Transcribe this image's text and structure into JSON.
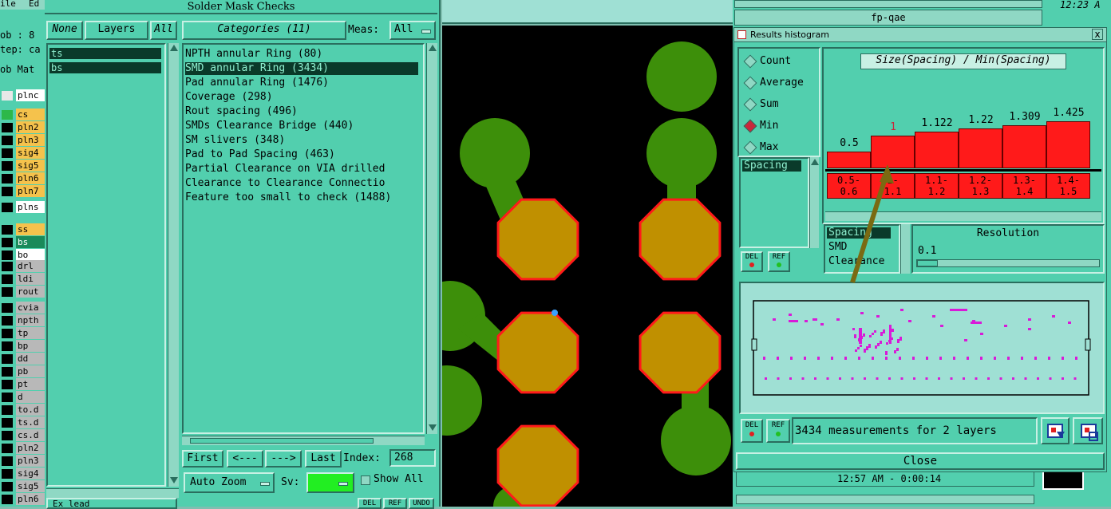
{
  "left_edge": {
    "menu": [
      "ile",
      "Ed"
    ],
    "rows": [
      "ob : 8",
      "tep: ca",
      "ob Mat"
    ]
  },
  "layers": [
    {
      "name": "plnc",
      "color": "#e8e8e8",
      "bg": "#ffffff"
    },
    {
      "name": "cs",
      "color": "#2db84a",
      "bg": "#f5c24c"
    },
    {
      "name": "pln2",
      "color": "#000000",
      "bg": "#f5c24c"
    },
    {
      "name": "pln3",
      "color": "#000000",
      "bg": "#f5c24c"
    },
    {
      "name": "sig4",
      "color": "#000000",
      "bg": "#f5c24c"
    },
    {
      "name": "sig5",
      "color": "#000000",
      "bg": "#f5c24c"
    },
    {
      "name": "pln6",
      "color": "#000000",
      "bg": "#f5c24c"
    },
    {
      "name": "pln7",
      "color": "#000000",
      "bg": "#f5c24c"
    },
    {
      "name": "plns",
      "color": "#000000",
      "bg": "#ffffff"
    },
    {
      "name": "ss",
      "color": "#000000",
      "bg": "#f5c24c"
    },
    {
      "name": "bs",
      "color": "#000000",
      "bg": "#1a8a5a"
    },
    {
      "name": "bo",
      "color": "#000000",
      "bg": "#ffffff"
    },
    {
      "name": "drl",
      "color": "#000000",
      "bg": "#b8b8b8"
    },
    {
      "name": "ldi",
      "color": "#000000",
      "bg": "#b8b8b8"
    },
    {
      "name": "rout",
      "color": "#000000",
      "bg": "#b8b8b8"
    },
    {
      "name": "cvia",
      "color": "#000000",
      "bg": "#b8b8b8"
    },
    {
      "name": "npth",
      "color": "#000000",
      "bg": "#b8b8b8"
    },
    {
      "name": "tp",
      "color": "#000000",
      "bg": "#b8b8b8"
    },
    {
      "name": "bp",
      "color": "#000000",
      "bg": "#b8b8b8"
    },
    {
      "name": "dd",
      "color": "#000000",
      "bg": "#b8b8b8"
    },
    {
      "name": "pb",
      "color": "#000000",
      "bg": "#b8b8b8"
    },
    {
      "name": "pt",
      "color": "#000000",
      "bg": "#b8b8b8"
    },
    {
      "name": "d",
      "color": "#000000",
      "bg": "#b8b8b8"
    },
    {
      "name": "to.d",
      "color": "#000000",
      "bg": "#b8b8b8"
    },
    {
      "name": "ts.d",
      "color": "#000000",
      "bg": "#b8b8b8"
    },
    {
      "name": "cs.d",
      "color": "#000000",
      "bg": "#b8b8b8"
    },
    {
      "name": "pln2",
      "color": "#000000",
      "bg": "#b8b8b8"
    },
    {
      "name": "pln3",
      "color": "#000000",
      "bg": "#b8b8b8"
    },
    {
      "name": "sig4",
      "color": "#000000",
      "bg": "#b8b8b8"
    },
    {
      "name": "sig5",
      "color": "#000000",
      "bg": "#b8b8b8"
    },
    {
      "name": "pln6",
      "color": "#000000",
      "bg": "#b8b8b8"
    }
  ],
  "smc": {
    "title": "Solder Mask Checks",
    "none_label": "None",
    "layers_label": "Layers",
    "all_label": "All",
    "layer_list": [
      "ts",
      "bs"
    ],
    "categories_label": "Categories (11)",
    "meas_label": "Meas:",
    "meas_value": "All",
    "categories": [
      "NPTH annular Ring (80)",
      "SMD annular Ring (3434)",
      "Pad annular Ring (1476)",
      "Coverage (298)",
      "Rout spacing (496)",
      "SMDs Clearance Bridge (440)",
      "SM slivers (348)",
      "Pad to Pad Spacing (463)",
      "Partial Clearance on VIA drilled",
      "Clearance to Clearance Connectio",
      "Feature too small to check (1488)"
    ],
    "selected_category": 1,
    "first_label": "First",
    "prev_label": "<---",
    "next_label": "--->",
    "last_label": "Last",
    "index_label": "Index:",
    "index_value": "268",
    "autozoom_label": "Auto Zoom",
    "sv_label": "Sv:",
    "show_all_label": "Show All",
    "bottom_buttons": [
      "DEL",
      "REF",
      "UNDO"
    ],
    "bottom_left_label": "Ex lead"
  },
  "fpqae": {
    "title": "fp-qae",
    "clock": "12:23 A"
  },
  "histogram": {
    "title": "Results histogram",
    "close_x": "x",
    "modes": [
      "Count",
      "Average",
      "Sum",
      "Min",
      "Max"
    ],
    "selected_mode": 3,
    "measure_list": [
      "Spacing"
    ],
    "chart_title": "Size(Spacing) / Min(Spacing)",
    "attr_list": [
      "Spacing",
      "SMD",
      "Clearance"
    ],
    "resolution_label": "Resolution",
    "resolution_value": "0.1",
    "del_label": "DEL",
    "ref_label": "REF",
    "status_text": "3434 measurements for 2 layers",
    "close_label": "Close",
    "bg_time": "12:57 AM - 0:00:14"
  },
  "chart_data": {
    "type": "bar",
    "title": "Size(Spacing) / Min(Spacing)",
    "categories": [
      "0.5-0.6",
      "1-1.1",
      "1.1-1.2",
      "1.2-1.3",
      "1.3-1.4",
      "1.4-1.5"
    ],
    "value_labels": [
      "0.5",
      "1",
      "1.122",
      "1.22",
      "1.309",
      "1.425"
    ],
    "values": [
      0.5,
      1.0,
      1.122,
      1.22,
      1.309,
      1.425
    ],
    "bin_top": [
      "0.5-",
      "1-",
      "1.1-",
      "1.2-",
      "1.3-",
      "1.4-"
    ],
    "bin_bottom": [
      "0.6",
      "1.1",
      "1.2",
      "1.3",
      "1.4",
      "1.5"
    ],
    "highlight_index": 1,
    "colors": {
      "bar": "#ff1a1a",
      "highlight_label": "#c8283c"
    }
  },
  "colors": {
    "panel": "#52cfae",
    "pcb_bg": "#000000",
    "green_pad": "#3d8f0a",
    "smd_pad": "#c09000",
    "smd_outline": "#ff1a1a",
    "preview_marks": "#d81ad8",
    "arrow": "#7a6a12"
  }
}
